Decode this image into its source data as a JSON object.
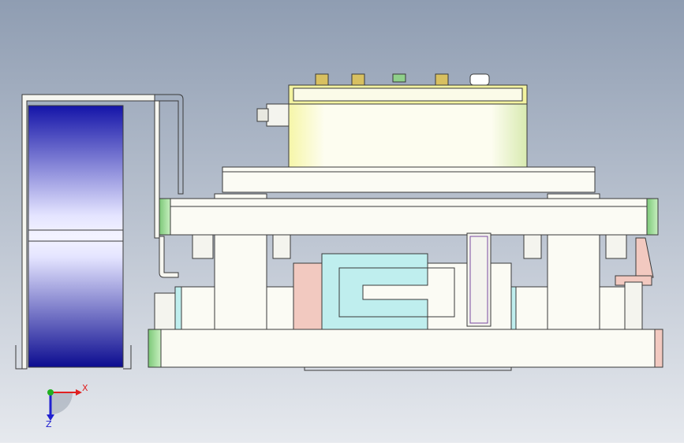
{
  "viewport": {
    "background_top": "#8f9db2",
    "background_bottom": "#e6e9ee"
  },
  "colors": {
    "outline": "#3a3a3a",
    "body_fill": "#fbfbf4",
    "green_end": "#8fd08a",
    "yellow_face": "#f3f3a0",
    "cyan_part": "#bfeeee",
    "pink_part": "#f2c9c0",
    "blue_roller_dark": "#1010a0",
    "blue_roller_light": "#e8e8ff",
    "brass": "#d8c060",
    "axis_x": "#e02020",
    "axis_y": "#20b020",
    "axis_z": "#2020d0"
  },
  "triad": {
    "x_label": "X",
    "z_label": "Z"
  }
}
